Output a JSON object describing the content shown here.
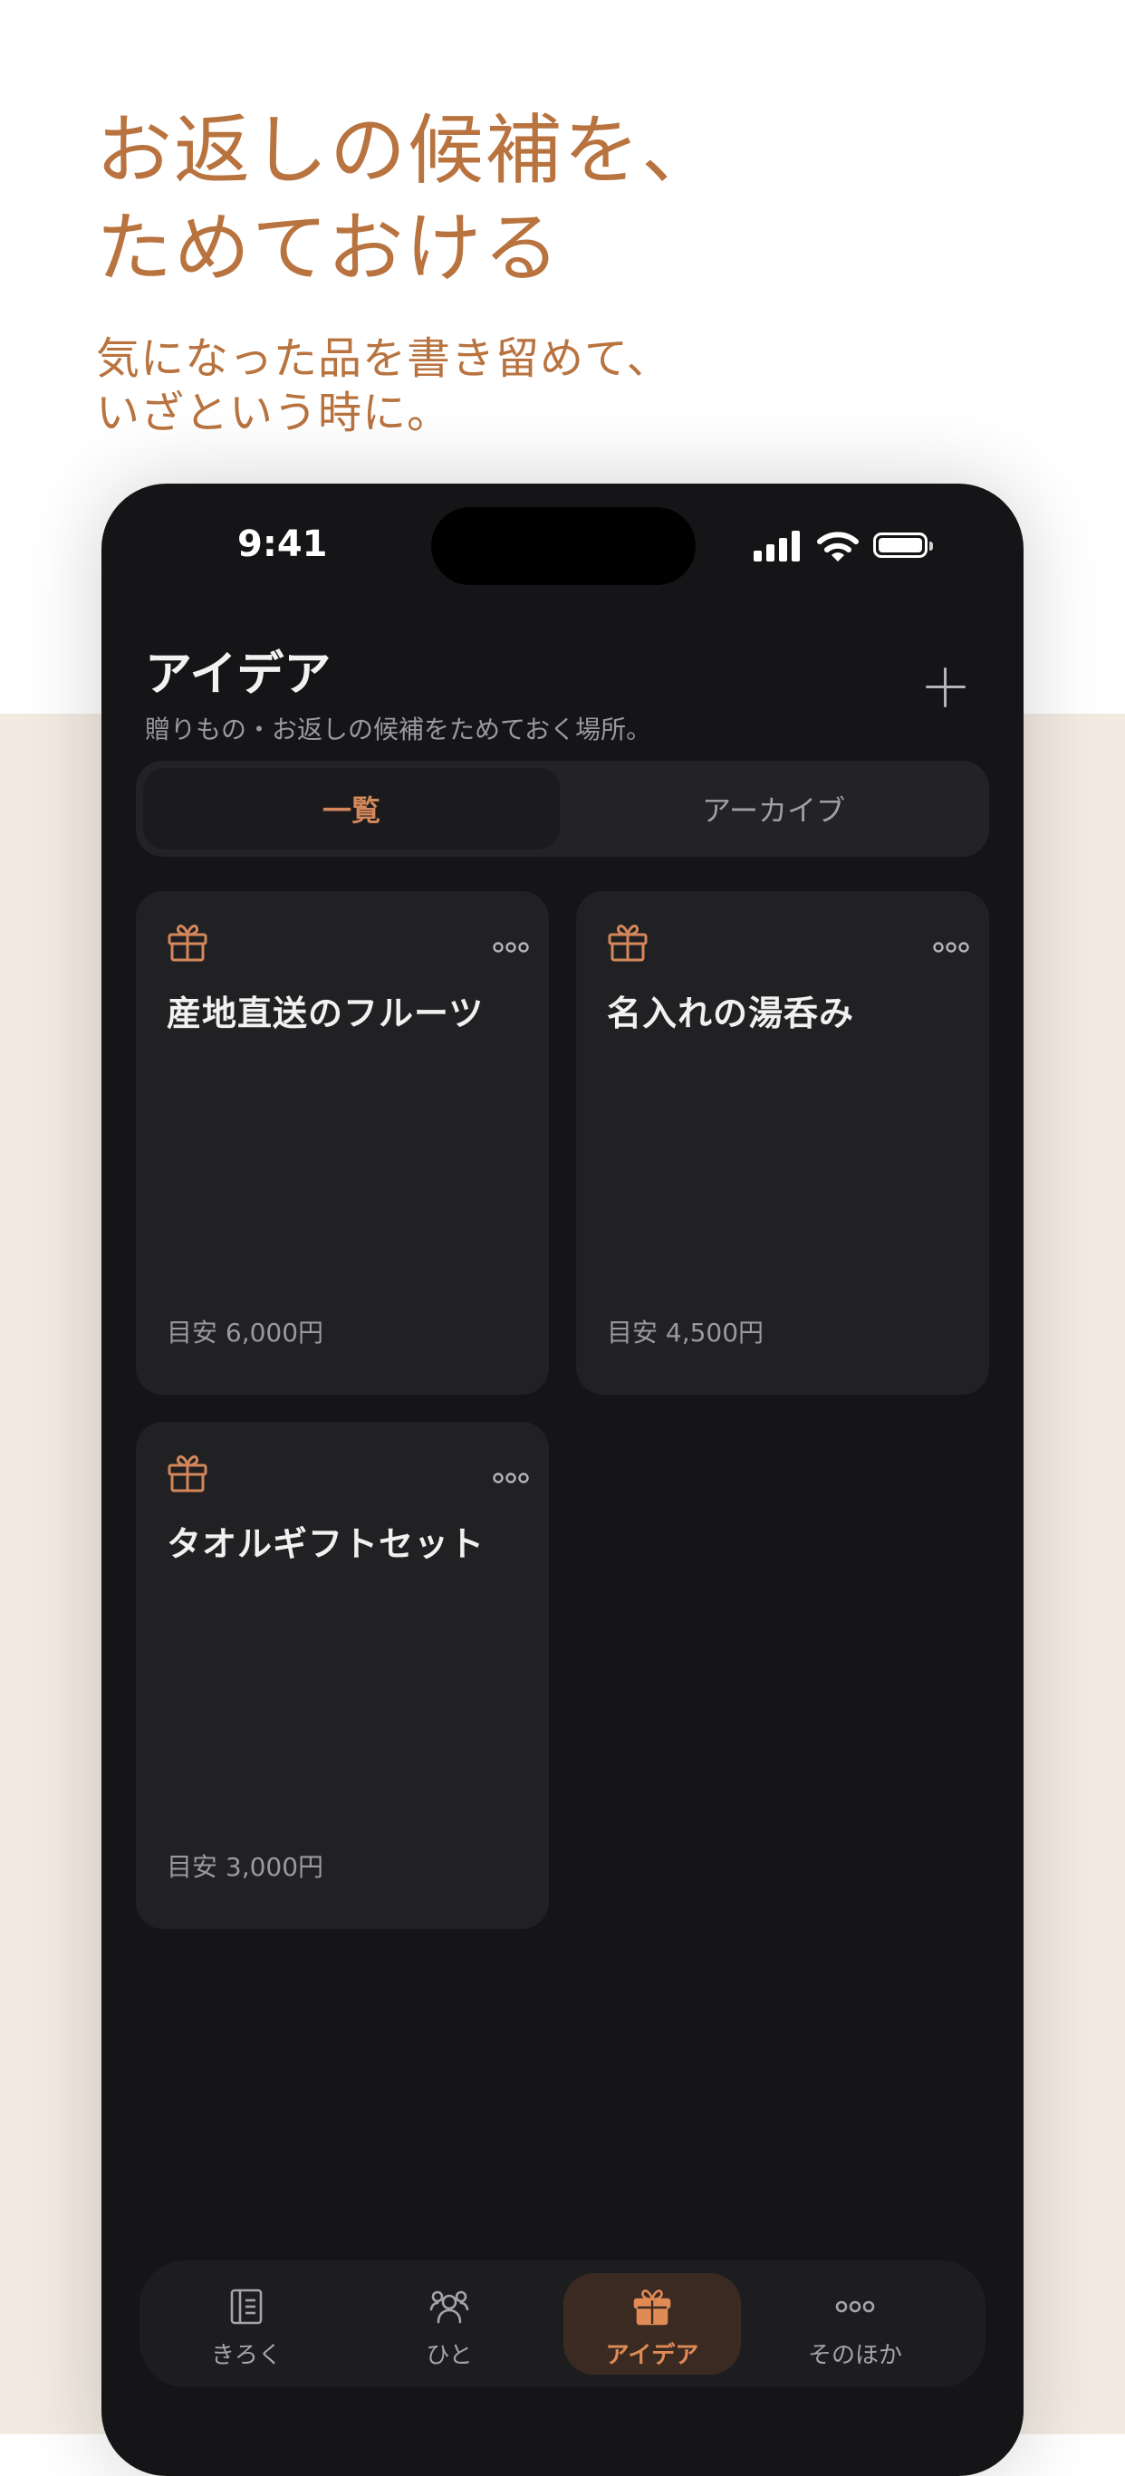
{
  "promo": {
    "headline_line1": "お返しの候補を、",
    "headline_line2": "ためておける",
    "subline_line1": "気になった品を書き留めて、",
    "subline_line2": "いざという時に。"
  },
  "status_bar": {
    "time": "9:41"
  },
  "header": {
    "title": "アイデア",
    "description": "贈りもの・お返しの候補をためておく場所。",
    "add_icon": "plus-icon"
  },
  "segment": {
    "tabs": [
      {
        "label": "一覧",
        "selected": true
      },
      {
        "label": "アーカイブ",
        "selected": false
      }
    ]
  },
  "ideas": [
    {
      "title": "産地直送のフルーツ",
      "price": "目安 6,000円",
      "icon": "gift-icon"
    },
    {
      "title": "名入れの湯呑み",
      "price": "目安 4,500円",
      "icon": "gift-icon"
    },
    {
      "title": "タオルギフトセット",
      "price": "目安 3,000円",
      "icon": "gift-icon"
    }
  ],
  "tabbar": {
    "items": [
      {
        "label": "きろく",
        "icon": "notebook-icon",
        "selected": false
      },
      {
        "label": "ひと",
        "icon": "people-icon",
        "selected": false
      },
      {
        "label": "アイデア",
        "icon": "gift-icon",
        "selected": true
      },
      {
        "label": "そのほか",
        "icon": "more-icon",
        "selected": false
      }
    ]
  },
  "colors": {
    "accent": "#d3875a",
    "promo_text": "#b8733f",
    "background_dark": "#151517",
    "band": "#f3ebe2"
  }
}
